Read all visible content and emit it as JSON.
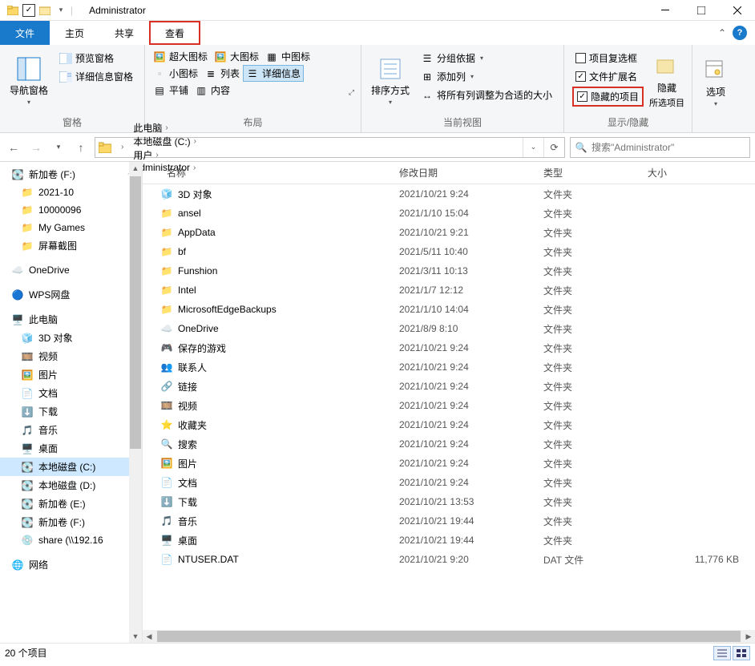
{
  "window": {
    "title": "Administrator"
  },
  "tabs": {
    "file": "文件",
    "home": "主页",
    "share": "共享",
    "view": "查看"
  },
  "ribbon": {
    "panes": {
      "nav_pane": "导航窗格",
      "preview_pane": "预览窗格",
      "details_pane": "详细信息窗格",
      "group_label": "窗格"
    },
    "layout": {
      "extra_large": "超大图标",
      "large_icons": "大图标",
      "medium_icons": "中图标",
      "small_icons": "小图标",
      "list": "列表",
      "details": "详细信息",
      "tiles": "平铺",
      "content": "内容",
      "group_label": "布局"
    },
    "view": {
      "sort_by": "排序方式",
      "group_by": "分组依据",
      "add_columns": "添加列",
      "size_all": "将所有列调整为合适的大小",
      "group_label": "当前视图"
    },
    "show_hide": {
      "item_check": "项目复选框",
      "ext": "文件扩展名",
      "hidden": "隐藏的项目",
      "hide_selected": "隐藏",
      "hide_selected_sub": "所选项目",
      "group_label": "显示/隐藏"
    },
    "options": "选项"
  },
  "breadcrumb": {
    "items": [
      "此电脑",
      "本地磁盘 (C:)",
      "用户",
      "Administrator"
    ]
  },
  "search": {
    "placeholder": "搜索\"Administrator\""
  },
  "columns": {
    "name": "名称",
    "date": "修改日期",
    "type": "类型",
    "size": "大小"
  },
  "tree": [
    {
      "label": "新加卷 (F:)",
      "icon": "drive",
      "root": true,
      "pin": true
    },
    {
      "label": "2021-10",
      "icon": "folder"
    },
    {
      "label": "10000096",
      "icon": "folder"
    },
    {
      "label": "My Games",
      "icon": "folder"
    },
    {
      "label": "屏幕截图",
      "icon": "folder"
    },
    {
      "spacer": true
    },
    {
      "label": "OneDrive",
      "icon": "onedrive",
      "root": true
    },
    {
      "spacer": true
    },
    {
      "label": "WPS网盘",
      "icon": "wps",
      "root": true
    },
    {
      "spacer": true
    },
    {
      "label": "此电脑",
      "icon": "pc",
      "root": true
    },
    {
      "label": "3D 对象",
      "icon": "3d"
    },
    {
      "label": "视频",
      "icon": "video"
    },
    {
      "label": "图片",
      "icon": "pictures"
    },
    {
      "label": "文档",
      "icon": "doc"
    },
    {
      "label": "下载",
      "icon": "download"
    },
    {
      "label": "音乐",
      "icon": "music"
    },
    {
      "label": "桌面",
      "icon": "desktop"
    },
    {
      "label": "本地磁盘 (C:)",
      "icon": "drive",
      "selected": true
    },
    {
      "label": "本地磁盘 (D:)",
      "icon": "drive"
    },
    {
      "label": "新加卷 (E:)",
      "icon": "drive"
    },
    {
      "label": "新加卷 (F:)",
      "icon": "drive"
    },
    {
      "label": "share (\\\\192.16",
      "icon": "netdrive"
    },
    {
      "spacer": true
    },
    {
      "label": "网络",
      "icon": "network",
      "root": true
    }
  ],
  "files": [
    {
      "name": "3D 对象",
      "date": "2021/10/21 9:24",
      "type": "文件夹",
      "size": "",
      "icon": "3d"
    },
    {
      "name": "ansel",
      "date": "2021/1/10 15:04",
      "type": "文件夹",
      "size": "",
      "icon": "folder"
    },
    {
      "name": "AppData",
      "date": "2021/10/21 9:21",
      "type": "文件夹",
      "size": "",
      "icon": "folder"
    },
    {
      "name": "bf",
      "date": "2021/5/11 10:40",
      "type": "文件夹",
      "size": "",
      "icon": "folder"
    },
    {
      "name": "Funshion",
      "date": "2021/3/11 10:13",
      "type": "文件夹",
      "size": "",
      "icon": "folder"
    },
    {
      "name": "Intel",
      "date": "2021/1/7 12:12",
      "type": "文件夹",
      "size": "",
      "icon": "folder"
    },
    {
      "name": "MicrosoftEdgeBackups",
      "date": "2021/1/10 14:04",
      "type": "文件夹",
      "size": "",
      "icon": "folder"
    },
    {
      "name": "OneDrive",
      "date": "2021/8/9 8:10",
      "type": "文件夹",
      "size": "",
      "icon": "onedrive"
    },
    {
      "name": "保存的游戏",
      "date": "2021/10/21 9:24",
      "type": "文件夹",
      "size": "",
      "icon": "games"
    },
    {
      "name": "联系人",
      "date": "2021/10/21 9:24",
      "type": "文件夹",
      "size": "",
      "icon": "contacts"
    },
    {
      "name": "链接",
      "date": "2021/10/21 9:24",
      "type": "文件夹",
      "size": "",
      "icon": "links"
    },
    {
      "name": "视频",
      "date": "2021/10/21 9:24",
      "type": "文件夹",
      "size": "",
      "icon": "video"
    },
    {
      "name": "收藏夹",
      "date": "2021/10/21 9:24",
      "type": "文件夹",
      "size": "",
      "icon": "fav"
    },
    {
      "name": "搜索",
      "date": "2021/10/21 9:24",
      "type": "文件夹",
      "size": "",
      "icon": "search"
    },
    {
      "name": "图片",
      "date": "2021/10/21 9:24",
      "type": "文件夹",
      "size": "",
      "icon": "pictures"
    },
    {
      "name": "文档",
      "date": "2021/10/21 9:24",
      "type": "文件夹",
      "size": "",
      "icon": "doc"
    },
    {
      "name": "下载",
      "date": "2021/10/21 13:53",
      "type": "文件夹",
      "size": "",
      "icon": "download"
    },
    {
      "name": "音乐",
      "date": "2021/10/21 19:44",
      "type": "文件夹",
      "size": "",
      "icon": "music"
    },
    {
      "name": "桌面",
      "date": "2021/10/21 19:44",
      "type": "文件夹",
      "size": "",
      "icon": "desktop"
    },
    {
      "name": "NTUSER.DAT",
      "date": "2021/10/21 9:20",
      "type": "DAT 文件",
      "size": "11,776 KB",
      "icon": "file"
    }
  ],
  "status": {
    "count": "20 个项目"
  },
  "icons": {
    "folder": "📁",
    "drive": "💽",
    "netdrive": "💿",
    "onedrive": "☁️",
    "wps": "🔵",
    "pc": "🖥️",
    "3d": "🧊",
    "video": "🎞️",
    "pictures": "🖼️",
    "doc": "📄",
    "download": "⬇️",
    "music": "🎵",
    "desktop": "🖥️",
    "network": "🌐",
    "games": "🎮",
    "contacts": "👥",
    "links": "🔗",
    "fav": "⭐",
    "search": "🔍",
    "file": "📄"
  }
}
